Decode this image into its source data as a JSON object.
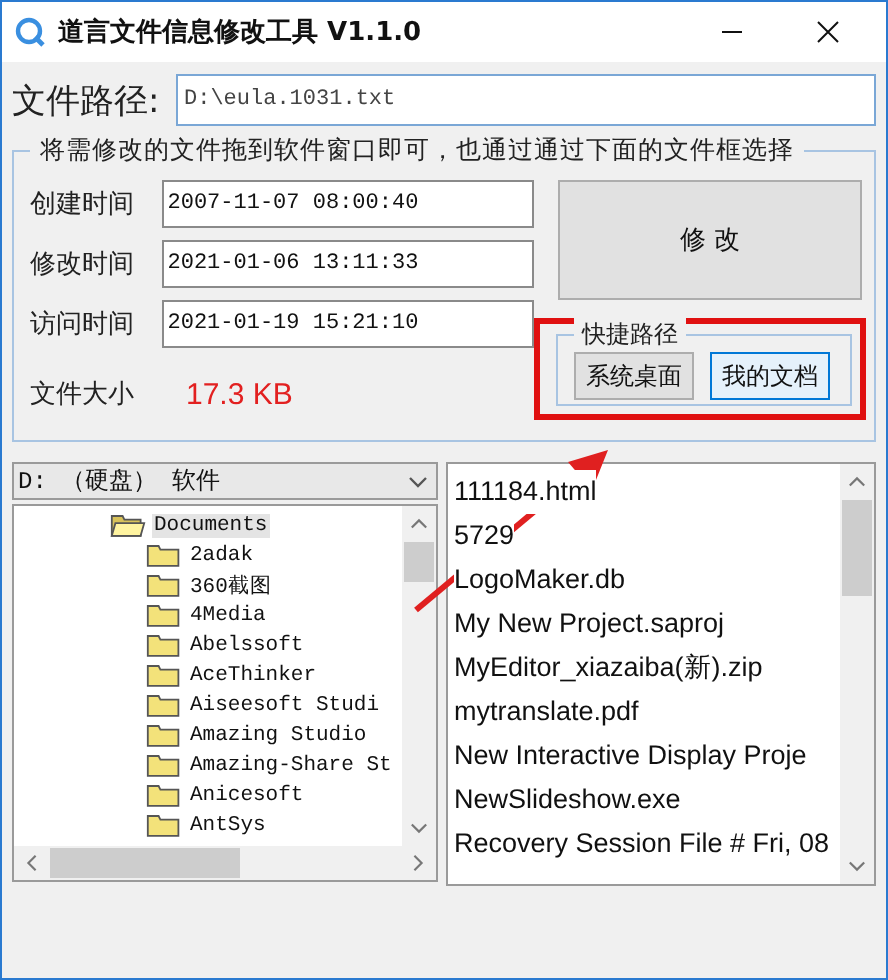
{
  "window": {
    "title": "道言文件信息修改工具 V1.1.0"
  },
  "path": {
    "label": "文件路径:",
    "value": "D:\\eula.1031.txt"
  },
  "group": {
    "legend": "将需修改的文件拖到软件窗口即可，也通过通过下面的文件框选择",
    "fields": [
      {
        "label": "创建时间",
        "value": "2007-11-07 08:00:40"
      },
      {
        "label": "修改时间",
        "value": "2021-01-06 13:11:33"
      },
      {
        "label": "访问时间",
        "value": "2021-01-19 15:21:10"
      }
    ],
    "size": {
      "label": "文件大小",
      "value": "17.3 KB"
    },
    "modify_button": "修 改",
    "shortcuts": {
      "legend": "快捷路径",
      "buttons": [
        {
          "label": "系统桌面",
          "selected": false
        },
        {
          "label": "我的文档",
          "selected": true
        }
      ]
    }
  },
  "drive": {
    "value": "D: （硬盘） 软件"
  },
  "folder_tree": {
    "items": [
      {
        "label": "Documents",
        "expanded": true,
        "selected": true,
        "children": [
          {
            "label": "2adak",
            "expanded": false,
            "selected": false
          },
          {
            "label": "360截图",
            "expanded": false,
            "selected": false
          },
          {
            "label": "4Media",
            "expanded": false,
            "selected": false
          },
          {
            "label": "Abelssoft",
            "expanded": false,
            "selected": false
          },
          {
            "label": "AceThinker",
            "expanded": false,
            "selected": false
          },
          {
            "label": "Aiseesoft Studi",
            "expanded": false,
            "selected": false
          },
          {
            "label": "Amazing Studio",
            "expanded": false,
            "selected": false
          },
          {
            "label": "Amazing-Share St",
            "expanded": false,
            "selected": false
          },
          {
            "label": "Anicesoft",
            "expanded": false,
            "selected": false
          },
          {
            "label": "AntSys",
            "expanded": false,
            "selected": false
          }
        ]
      }
    ]
  },
  "file_list": {
    "items": [
      "111184.html",
      "5729",
      "LogoMaker.db",
      "My New Project.saproj",
      "MyEditor_xiazaiba(新).zip",
      "mytranslate.pdf",
      "New Interactive Display Proje",
      "NewSlideshow.exe",
      "Recovery Session File # Fri, 08"
    ]
  }
}
